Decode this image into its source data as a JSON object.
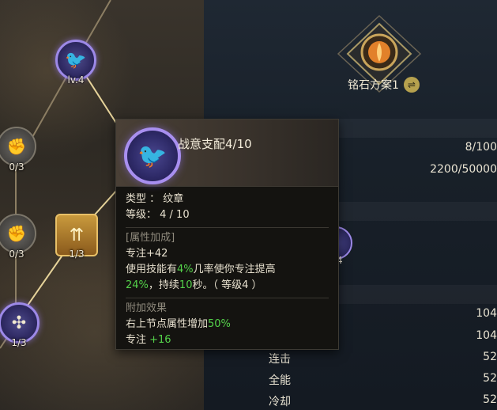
{
  "tree": {
    "nodes": [
      {
        "name": "top-node",
        "label": "lv.4"
      },
      {
        "name": "left-mid-node-1",
        "label": "0/3"
      },
      {
        "name": "left-mid-node-2",
        "label": "0/3"
      },
      {
        "name": "gold-node",
        "label": "1/3"
      },
      {
        "name": "bottom-node",
        "label": "1/3"
      }
    ]
  },
  "scheme": {
    "title": "铭石方案1",
    "swap_icon": "⇌"
  },
  "stats": {
    "row1": "8/100",
    "row2": "2200/50000",
    "partial_label": "4",
    "v1": "104",
    "v2": "104",
    "v3": "52",
    "v4": "52",
    "v5": "52",
    "name3": "连击",
    "name4": "全能",
    "name5": "冷却"
  },
  "tooltip": {
    "title": "战意支配4/10",
    "type_line": "类型 ： 纹章",
    "level_line": "等级： 4 / 10",
    "attr_header": "[属性加成]",
    "attr_line": "专注+42",
    "effect_p1": "使用技能有",
    "effect_pct1": "4%",
    "effect_p2": "几率使你专注提高",
    "effect_pct2": "24%",
    "effect_p3": "，持续",
    "effect_sec": "10",
    "effect_p4": "秒。（ 等级4 ）",
    "extra_header": "附加效果",
    "extra_line1_a": "右上节点属性增加",
    "extra_line1_b": "50%",
    "extra_line2_a": "专注 ",
    "extra_line2_b": "+16"
  },
  "colors": {
    "accent_green": "#54d24a",
    "purple_ring": "#a88ff0",
    "gold": "#e8c067"
  }
}
